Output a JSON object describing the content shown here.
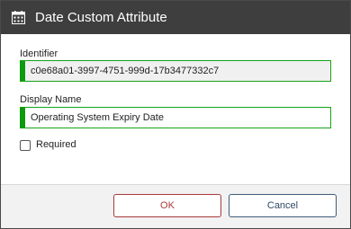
{
  "dialog": {
    "title": "Date Custom Attribute",
    "title_icon": "calendar-icon"
  },
  "form": {
    "identifier_label": "Identifier",
    "identifier_value": "c0e68a01-3997-4751-999d-17b3477332c7",
    "display_name_label": "Display Name",
    "display_name_value": "Operating System Expiry Date",
    "required_label": "Required",
    "required_checked": false
  },
  "footer": {
    "ok_label": "OK",
    "cancel_label": "Cancel"
  },
  "colors": {
    "titlebar": "#3e3e3e",
    "field_accent": "#0e9a0e",
    "ok_text": "#a83a3a",
    "cancel_border": "#3d5c7a"
  }
}
